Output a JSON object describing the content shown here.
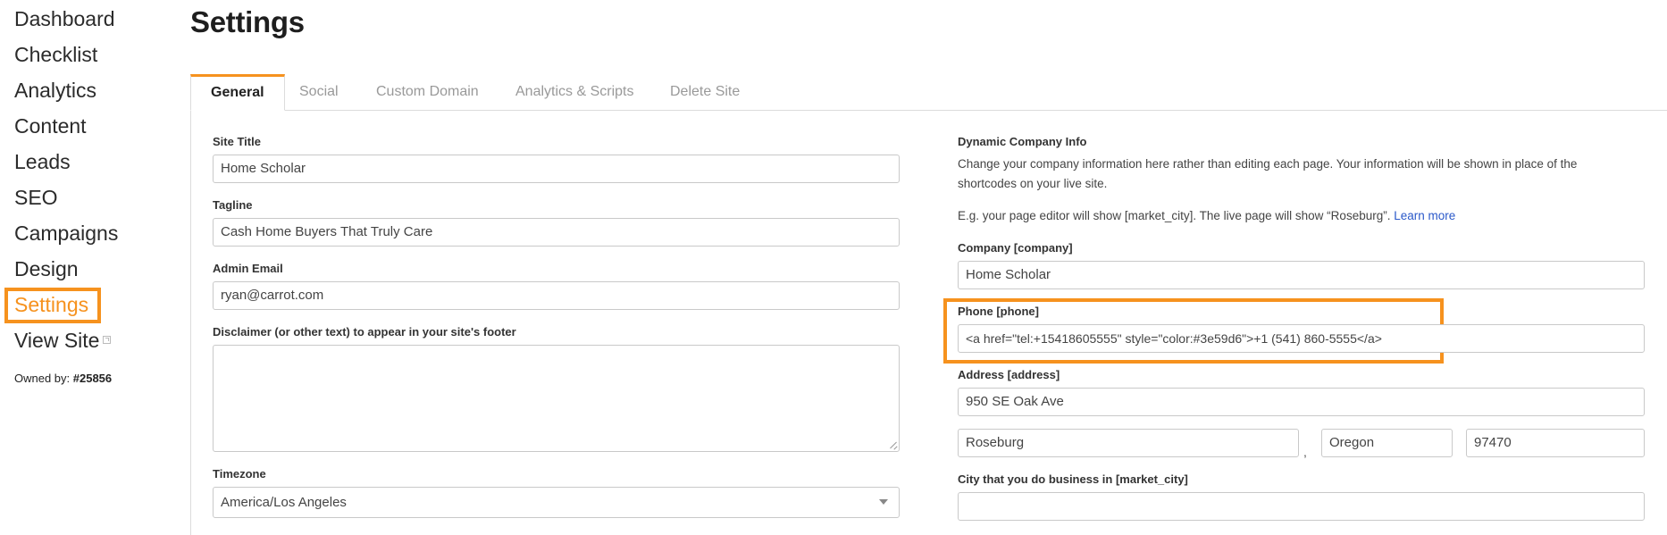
{
  "sidebar": {
    "items": [
      {
        "label": "Dashboard"
      },
      {
        "label": "Checklist"
      },
      {
        "label": "Analytics"
      },
      {
        "label": "Content"
      },
      {
        "label": "Leads"
      },
      {
        "label": "SEO"
      },
      {
        "label": "Campaigns"
      },
      {
        "label": "Design"
      },
      {
        "label": "Settings",
        "active": true
      },
      {
        "label": "View Site",
        "icon": "external-link-icon"
      }
    ],
    "owned_prefix": "Owned by: ",
    "owned_id": "#25856"
  },
  "page": {
    "title": "Settings"
  },
  "tabs": [
    {
      "label": "General",
      "active": true
    },
    {
      "label": "Social"
    },
    {
      "label": "Custom Domain"
    },
    {
      "label": "Analytics & Scripts"
    },
    {
      "label": "Delete Site"
    }
  ],
  "left_form": {
    "site_title": {
      "label": "Site Title",
      "value": "Home Scholar"
    },
    "tagline": {
      "label": "Tagline",
      "value": "Cash Home Buyers That Truly Care"
    },
    "admin_email": {
      "label": "Admin Email",
      "value": "ryan@carrot.com"
    },
    "disclaimer": {
      "label": "Disclaimer (or other text) to appear in your site's footer",
      "value": ""
    },
    "timezone": {
      "label": "Timezone",
      "value": "America/Los Angeles"
    }
  },
  "right_form": {
    "heading": "Dynamic Company Info",
    "description": "Change your company information here rather than editing each page. Your information will be shown in place of the shortcodes on your live site.",
    "example_text": "E.g. your page editor will show [market_city]. The live page will show “Roseburg”.",
    "learn_more": "Learn more",
    "company": {
      "label": "Company [company]",
      "value": "Home Scholar"
    },
    "phone": {
      "label": "Phone [phone]",
      "value": "<a href=\"tel:+15418605555\" style=\"color:#3e59d6\">+1 (541) 860-5555</a>"
    },
    "address": {
      "label": "Address [address]",
      "street": "950 SE Oak Ave",
      "city": "Roseburg",
      "separator": ",",
      "state": "Oregon",
      "zip": "97470"
    },
    "market_city": {
      "label": "City that you do business in [market_city]",
      "value": ""
    }
  },
  "colors": {
    "accent": "#f6921e",
    "link": "#2a58c9"
  }
}
